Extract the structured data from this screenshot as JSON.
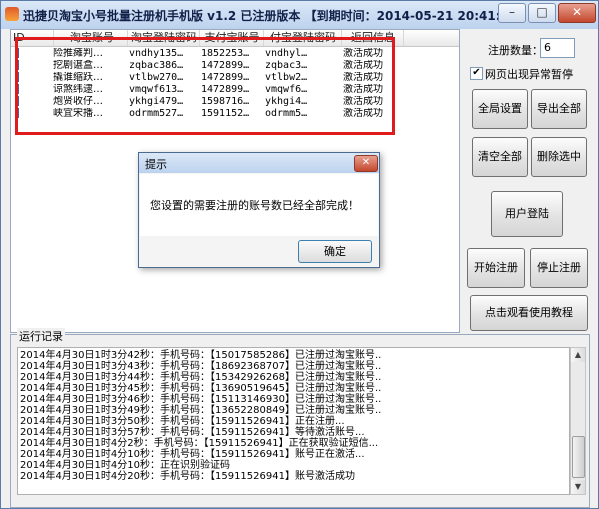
{
  "window": {
    "title": "迅捷贝淘宝小号批量注册机手机版 v1.2  已注册版本 【到期时间：2014-05-21 20:41:43】",
    "minimize_glyph": "–",
    "maximize_glyph": "□",
    "close_glyph": "✕"
  },
  "table": {
    "columns": [
      "ID",
      "淘宝账号",
      "淘宝登陆密码",
      "支付宝账号",
      "付宝登陆密码",
      "返回信息"
    ],
    "rows": [
      {
        "id": "1",
        "account": "险推瘫判…",
        "password": "vndhy135…",
        "alipay": "1852253…",
        "alipay_pwd": "vndhyl…",
        "status": "激活成功"
      },
      {
        "id": "2",
        "account": "挖剧谌盒…",
        "password": "zqbac386…",
        "alipay": "1472899…",
        "alipay_pwd": "zqbac3…",
        "status": "激活成功"
      },
      {
        "id": "3",
        "account": "撬谁缩跃…",
        "password": "vtlbw270…",
        "alipay": "1472899…",
        "alipay_pwd": "vtlbw2…",
        "status": "激活成功"
      },
      {
        "id": "4",
        "account": "谅煞纬逮…",
        "password": "vmqwf613…",
        "alipay": "1472899…",
        "alipay_pwd": "vmqwf6…",
        "status": "激活成功"
      },
      {
        "id": "5",
        "account": "炮贤收仔…",
        "password": "ykhgi479…",
        "alipay": "1598716…",
        "alipay_pwd": "ykhgi4…",
        "status": "激活成功"
      },
      {
        "id": "6",
        "account": "峡宜宋播…",
        "password": "odrmm527…",
        "alipay": "1591152…",
        "alipay_pwd": "odrmm5…",
        "status": "激活成功"
      }
    ]
  },
  "controls": {
    "reg_count_label": "注册数量：",
    "reg_count_value": "6",
    "pause_on_error_label": "网页出现异常暂停",
    "pause_on_error_checked": "✔",
    "global_settings": "全局设置",
    "export_all": "导出全部",
    "clear_all": "清空全部",
    "delete_selected": "删除选中",
    "user_login": "用户登陆",
    "start_register": "开始注册",
    "stop_register": "停止注册",
    "watch_tutorial": "点击观看使用教程"
  },
  "log": {
    "title": "运行记录",
    "lines": [
      "2014年4月30日1时3分42秒：手机号码：【15017585286】已注册过淘宝账号..",
      "2014年4月30日1时3分43秒：手机号码：【18692368707】已注册过淘宝账号..",
      "2014年4月30日1时3分44秒：手机号码：【15342926268】已注册过淘宝账号..",
      "2014年4月30日1时3分45秒：手机号码：【13690519645】已注册过淘宝账号..",
      "2014年4月30日1时3分46秒：手机号码：【15113146930】已注册过淘宝账号..",
      "2014年4月30日1时3分49秒：手机号码：【13652280849】已注册过淘宝账号..",
      "2014年4月30日1时3分50秒：手机号码：【15911526941】正在注册...",
      "2014年4月30日1时3分57秒：手机号码：【15911526941】等待激活账号...",
      "2014年4月30日1时4分2秒：手机号码：【15911526941】正在获取验证短信...",
      "2014年4月30日1时4分10秒：手机号码：【15911526941】账号正在激活...",
      "2014年4月30日1时4分10秒：正在识别验证码",
      "2014年4月30日1时4分20秒：手机号码：【15911526941】账号激活成功"
    ]
  },
  "dialog": {
    "title": "提示",
    "close_glyph": "✕",
    "message": "您设置的需要注册的账号数已经全部完成！",
    "ok": "确定"
  },
  "scrollbar": {
    "up": "▲",
    "down": "▼"
  },
  "colors": {
    "highlight_border": "#e01b1b",
    "title_bar": "#bcd2ee"
  }
}
